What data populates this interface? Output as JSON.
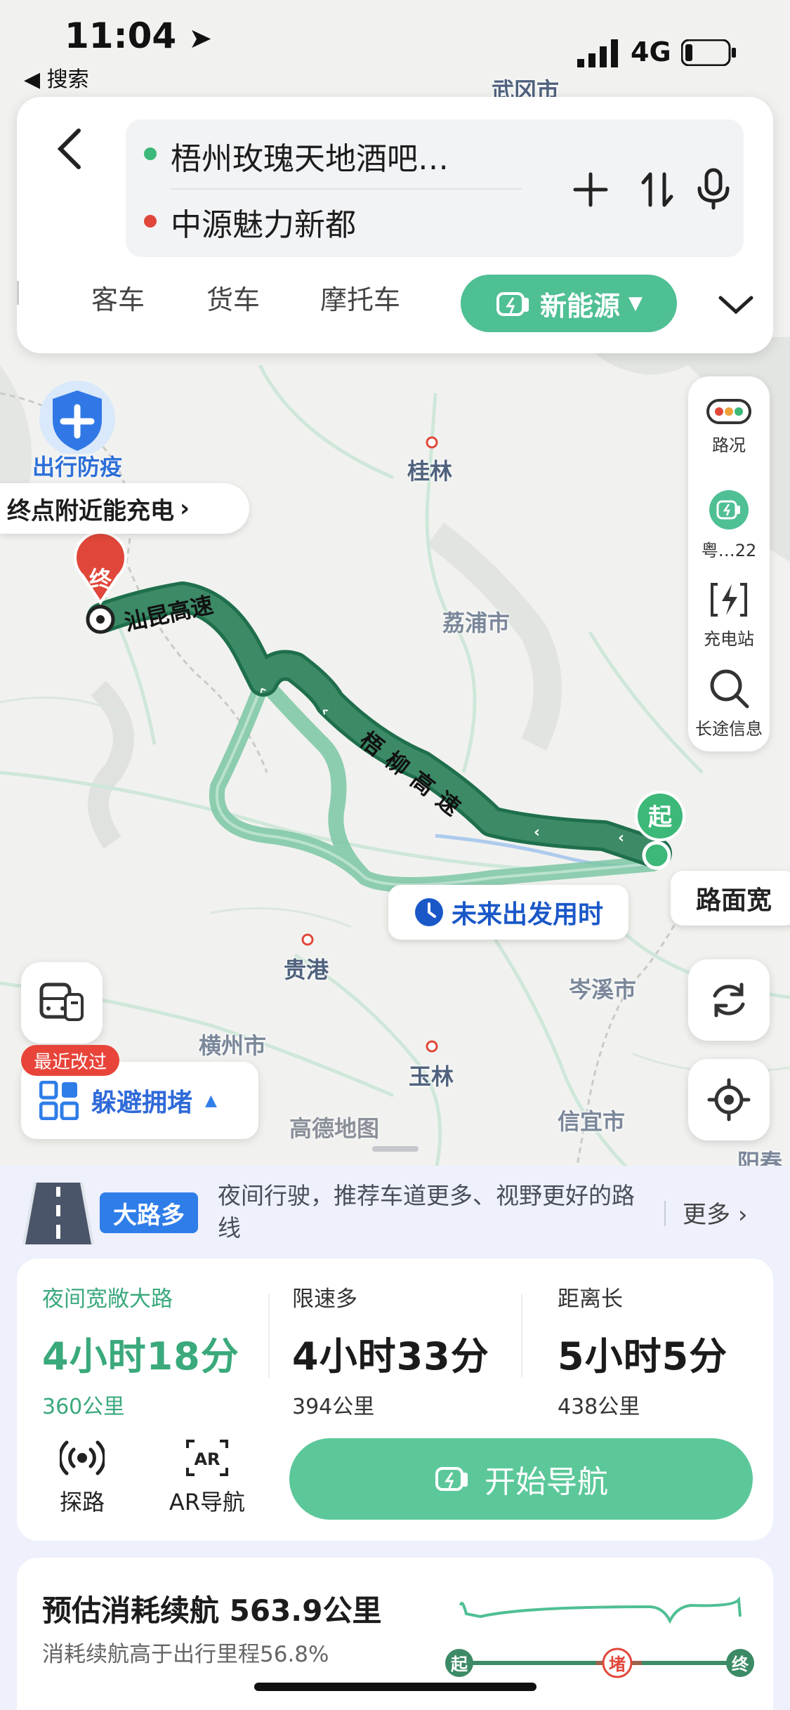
{
  "status_bar": {
    "time": "11:04",
    "back_app": "◀ 搜索",
    "network": "4G"
  },
  "search": {
    "origin": "梧州玫瑰天地酒吧…",
    "destination": "中源魅力新都",
    "origin_color": "#3cb878",
    "destination_color": "#e0473a"
  },
  "modes": {
    "coach": "客车",
    "truck": "货车",
    "motorcycle": "摩托车",
    "new_energy": "新能源"
  },
  "right_toolbar": {
    "traffic": "路况",
    "vehicle": "粤…22",
    "charging": "充电站",
    "long_trip": "长途信息"
  },
  "map": {
    "epidemic_badge": "出行防疫",
    "charge_bubble": "终点附近能充电",
    "end_marker": "终",
    "start_marker": "起",
    "departure_bubble": "未来出发用时",
    "road_bubble": "路面宽",
    "highway_1": "汕昆高速",
    "highway_2": "梧柳高速",
    "cities": [
      "武冈市",
      "桂林",
      "荔浦市",
      "贵港",
      "岑溪市",
      "横州市",
      "玉林",
      "信宜市",
      "阳春"
    ],
    "recent_badge": "最近改过",
    "avoid_label": "躲避拥堵",
    "logo": "高德地图"
  },
  "banner": {
    "tag": "大路多",
    "text": "夜间行驶，推荐车道更多、视野更好的路线",
    "more": "更多"
  },
  "routes": [
    {
      "tag": "夜间宽敞大路",
      "time": "4小时18分",
      "distance": "360公里",
      "selected": true
    },
    {
      "tag": "限速多",
      "time": "4小时33分",
      "distance": "394公里",
      "selected": false
    },
    {
      "tag": "距离长",
      "time": "5小时5分",
      "distance": "438公里",
      "selected": false
    }
  ],
  "actions": {
    "explore": "探路",
    "ar": "AR导航",
    "start_nav": "开始导航"
  },
  "range": {
    "title": "预估消耗续航 563.9公里",
    "subtitle": "消耗续航高于出行里程56.8%",
    "start": "起",
    "jam": "堵",
    "end": "终"
  },
  "colors": {
    "accent": "#4fbf94",
    "route_main": "#2f7d5b",
    "route_alt": "#7cc7a5",
    "selected_text": "#3aa97b",
    "banner_tag": "#2f7de8"
  }
}
